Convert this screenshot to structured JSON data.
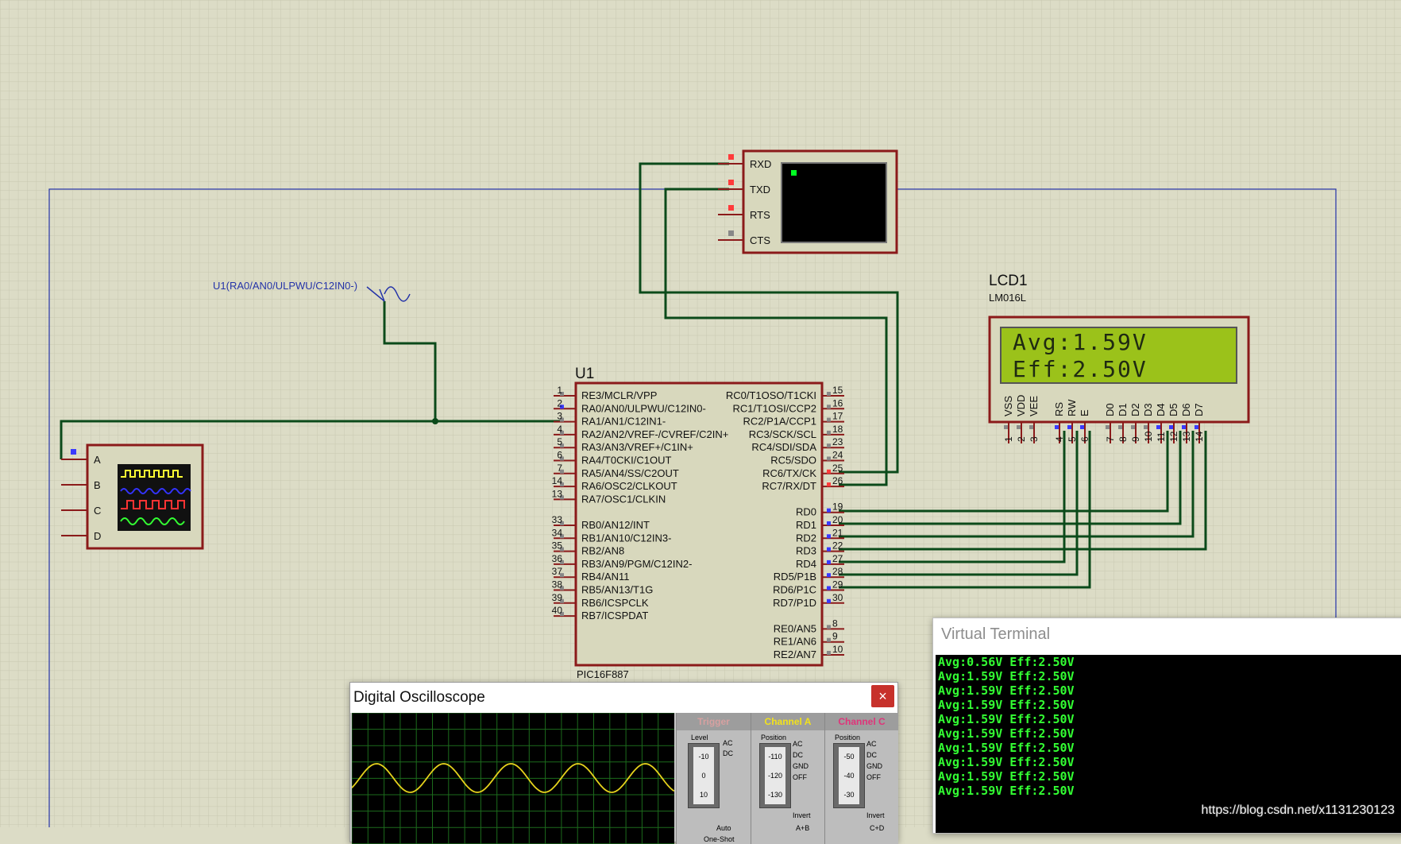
{
  "schematic": {
    "mcu": {
      "ref": "U1",
      "part": "PIC16F887",
      "left_pins": [
        {
          "num": "1",
          "name": "RE3/MCLR/VPP"
        },
        {
          "num": "2",
          "name": "RA0/AN0/ULPWU/C12IN0-"
        },
        {
          "num": "3",
          "name": "RA1/AN1/C12IN1-"
        },
        {
          "num": "4",
          "name": "RA2/AN2/VREF-/CVREF/C2IN+"
        },
        {
          "num": "5",
          "name": "RA3/AN3/VREF+/C1IN+"
        },
        {
          "num": "6",
          "name": "RA4/T0CKI/C1OUT"
        },
        {
          "num": "7",
          "name": "RA5/AN4/SS/C2OUT"
        },
        {
          "num": "14",
          "name": "RA6/OSC2/CLKOUT"
        },
        {
          "num": "13",
          "name": "RA7/OSC1/CLKIN"
        },
        {
          "num": "33",
          "name": "RB0/AN12/INT"
        },
        {
          "num": "34",
          "name": "RB1/AN10/C12IN3-"
        },
        {
          "num": "35",
          "name": "RB2/AN8"
        },
        {
          "num": "36",
          "name": "RB3/AN9/PGM/C12IN2-"
        },
        {
          "num": "37",
          "name": "RB4/AN11"
        },
        {
          "num": "38",
          "name": "RB5/AN13/T1G"
        },
        {
          "num": "39",
          "name": "RB6/ICSPCLK"
        },
        {
          "num": "40",
          "name": "RB7/ICSPDAT"
        }
      ],
      "right_pins": [
        {
          "num": "15",
          "name": "RC0/T1OSO/T1CKI"
        },
        {
          "num": "16",
          "name": "RC1/T1OSI/CCP2"
        },
        {
          "num": "17",
          "name": "RC2/P1A/CCP1"
        },
        {
          "num": "18",
          "name": "RC3/SCK/SCL"
        },
        {
          "num": "23",
          "name": "RC4/SDI/SDA"
        },
        {
          "num": "24",
          "name": "RC5/SDO"
        },
        {
          "num": "25",
          "name": "RC6/TX/CK"
        },
        {
          "num": "26",
          "name": "RC7/RX/DT"
        },
        {
          "num": "19",
          "name": "RD0"
        },
        {
          "num": "20",
          "name": "RD1"
        },
        {
          "num": "21",
          "name": "RD2"
        },
        {
          "num": "22",
          "name": "RD3"
        },
        {
          "num": "27",
          "name": "RD4"
        },
        {
          "num": "28",
          "name": "RD5/P1B"
        },
        {
          "num": "29",
          "name": "RD6/P1C"
        },
        {
          "num": "30",
          "name": "RD7/P1D"
        },
        {
          "num": "8",
          "name": "RE0/AN5"
        },
        {
          "num": "9",
          "name": "RE1/AN6"
        },
        {
          "num": "10",
          "name": "RE2/AN7"
        }
      ]
    },
    "lcd": {
      "ref": "LCD1",
      "part": "LM016L",
      "line1": "Avg:1.59V",
      "line2": "Eff:2.50V",
      "pins": [
        {
          "label": "VSS",
          "num": "1"
        },
        {
          "label": "VDD",
          "num": "2"
        },
        {
          "label": "VEE",
          "num": "3"
        },
        {
          "label": "RS",
          "num": "4"
        },
        {
          "label": "RW",
          "num": "5"
        },
        {
          "label": "E",
          "num": "6"
        },
        {
          "label": "D0",
          "num": "7"
        },
        {
          "label": "D1",
          "num": "8"
        },
        {
          "label": "D2",
          "num": "9"
        },
        {
          "label": "D3",
          "num": "10"
        },
        {
          "label": "D4",
          "num": "11"
        },
        {
          "label": "D5",
          "num": "12"
        },
        {
          "label": "D6",
          "num": "13"
        },
        {
          "label": "D7",
          "num": "14"
        }
      ]
    },
    "terminal_pins": [
      "RXD",
      "TXD",
      "RTS",
      "CTS"
    ],
    "generator_label": "U1(RA0/AN0/ULPWU/C12IN0-)",
    "scope_channels": [
      "A",
      "B",
      "C",
      "D"
    ]
  },
  "virtual_terminal": {
    "title": "Virtual Terminal",
    "lines": [
      "Avg:0.56V Eff:2.50V",
      "Avg:1.59V Eff:2.50V",
      "Avg:1.59V Eff:2.50V",
      "Avg:1.59V Eff:2.50V",
      "Avg:1.59V Eff:2.50V",
      "Avg:1.59V Eff:2.50V",
      "Avg:1.59V Eff:2.50V",
      "Avg:1.59V Eff:2.50V",
      "Avg:1.59V Eff:2.50V",
      "Avg:1.59V Eff:2.50V"
    ]
  },
  "oscilloscope": {
    "title": "Digital Oscilloscope",
    "close_label": "×",
    "trigger": {
      "title": "Trigger",
      "level_label": "Level",
      "ticks": [
        "-10",
        "0",
        "10"
      ],
      "coupling": [
        "AC",
        "DC"
      ],
      "auto_label": "Auto",
      "oneshot_label": "One-Shot"
    },
    "channel_a": {
      "title": "Channel A",
      "position_label": "Position",
      "ticks": [
        "-110",
        "-120",
        "-130"
      ],
      "coupling": [
        "AC",
        "DC",
        "GND",
        "OFF"
      ],
      "invert_label": "Invert",
      "sum_label": "A+B"
    },
    "channel_c": {
      "title": "Channel C",
      "position_label": "Position",
      "ticks": [
        "-50",
        "-40",
        "-30"
      ],
      "coupling": [
        "AC",
        "DC",
        "GND",
        "OFF"
      ],
      "invert_label": "Invert",
      "sum_label": "C+D"
    }
  },
  "watermark": "https://blog.csdn.net/x1131230123",
  "colors": {
    "wire": "#0b4a1a",
    "component_border": "#8b1a1a",
    "canvas": "#dcdcc6",
    "grid": "#c9c9b3",
    "terminal_text": "#33ff33",
    "lcd_bg": "#9bc21a"
  }
}
